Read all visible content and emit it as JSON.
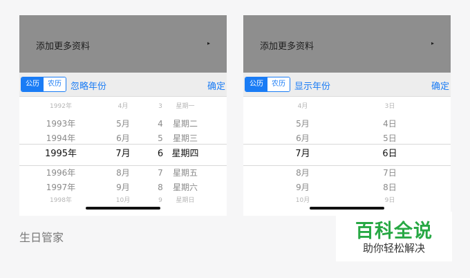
{
  "left_phone": {
    "overlay_label": "添加更多资料",
    "overlay_arrow": "▸",
    "calendar_solar": "公历",
    "calendar_lunar": "农历",
    "year_toggle": "忽略年份",
    "confirm": "确定",
    "columns": {
      "year": [
        "1992年",
        "1993年",
        "1994年",
        "1995年",
        "1996年",
        "1997年",
        "1998年"
      ],
      "month": [
        "4月",
        "5月",
        "6月",
        "7月",
        "8月",
        "9月",
        "10月"
      ],
      "day": [
        "3",
        "4",
        "5",
        "6",
        "7",
        "8",
        "9"
      ],
      "weekday": [
        "星期一",
        "星期二",
        "星期三",
        "星期四",
        "星期五",
        "星期六",
        "星期日"
      ]
    }
  },
  "right_phone": {
    "overlay_label": "添加更多资料",
    "overlay_arrow": "▸",
    "calendar_solar": "公历",
    "calendar_lunar": "农历",
    "year_toggle": "显示年份",
    "confirm": "确定",
    "columns": {
      "month": [
        "4月",
        "5月",
        "6月",
        "7月",
        "8月",
        "9月",
        "10月"
      ],
      "day": [
        "3日",
        "4日",
        "5日",
        "6日",
        "7日",
        "8日",
        "9日"
      ]
    }
  },
  "caption": "生日管家",
  "watermark": {
    "main": "百科全说",
    "sub": "助你轻松解决"
  },
  "colors": {
    "accent": "#1a7cf5",
    "overlay": "#8e8e8e",
    "watermark_green": "#27a844"
  }
}
